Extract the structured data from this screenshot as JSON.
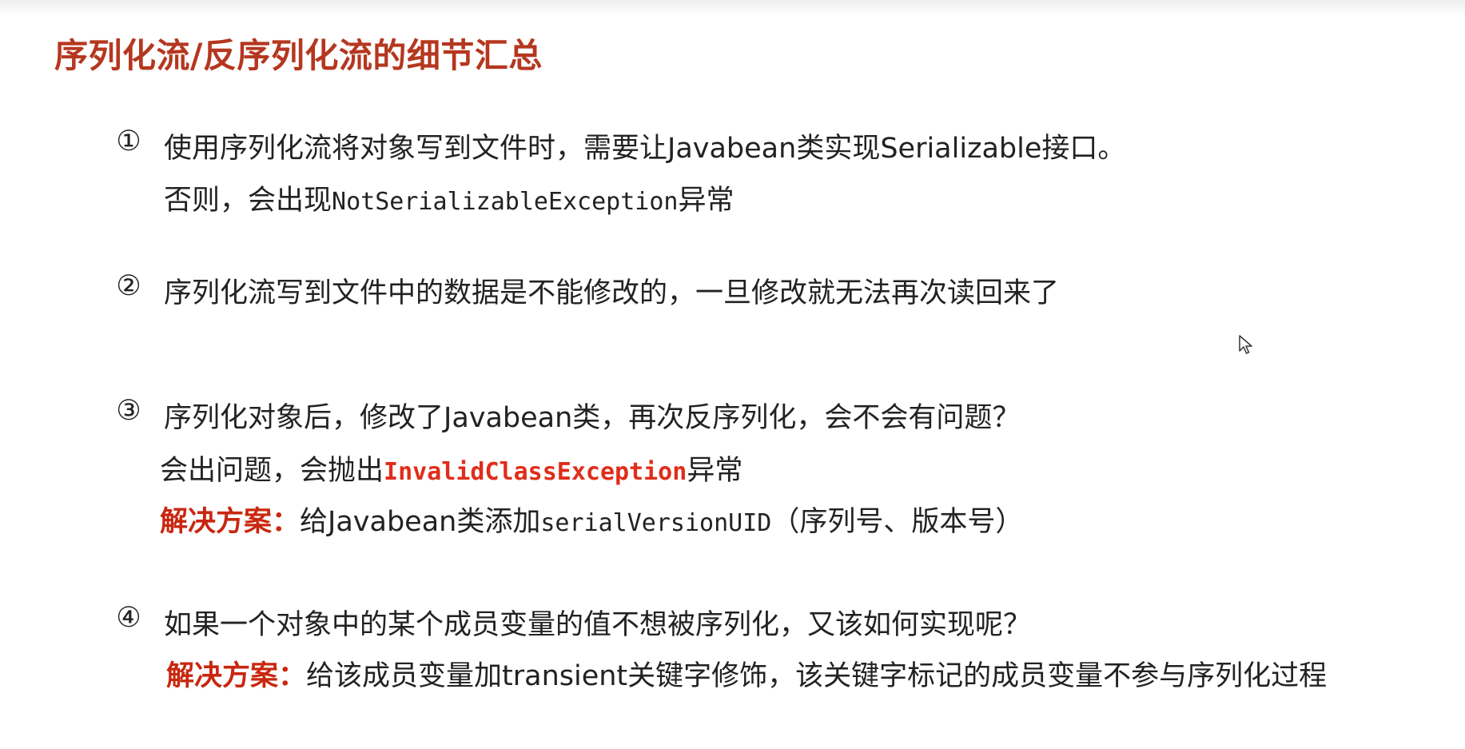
{
  "title": "序列化流/反序列化流的细节汇总",
  "items": [
    {
      "marker": "①",
      "line1": "使用序列化流将对象写到文件时，需要让Javabean类实现Serializable接口。",
      "line2_prefix": "否则，会出现",
      "line2_code": "NotSerializableException",
      "line2_suffix": "异常"
    },
    {
      "marker": "②",
      "line1": "序列化流写到文件中的数据是不能修改的，一旦修改就无法再次读回来了"
    },
    {
      "marker": "③",
      "line1": "序列化对象后，修改了Javabean类，再次反序列化，会不会有问题？",
      "line2_prefix": "会出问题，会抛出",
      "line2_code": "InvalidClassException",
      "line2_suffix": "异常",
      "solution_label": "解决方案：",
      "solution_prefix": "给Javabean类添加",
      "solution_code": "serialVersionUID",
      "solution_suffix": "（序列号、版本号）"
    },
    {
      "marker": "④",
      "line1": "如果一个对象中的某个成员变量的值不想被序列化，又该如何实现呢？",
      "solution_label": "解决方案：",
      "solution_text": "给该成员变量加transient关键字修饰，该关键字标记的成员变量不参与序列化过程"
    }
  ],
  "colors": {
    "title": "#b5371f",
    "label": "#c8270f",
    "code_red": "#e02d1b",
    "text": "#222222"
  }
}
